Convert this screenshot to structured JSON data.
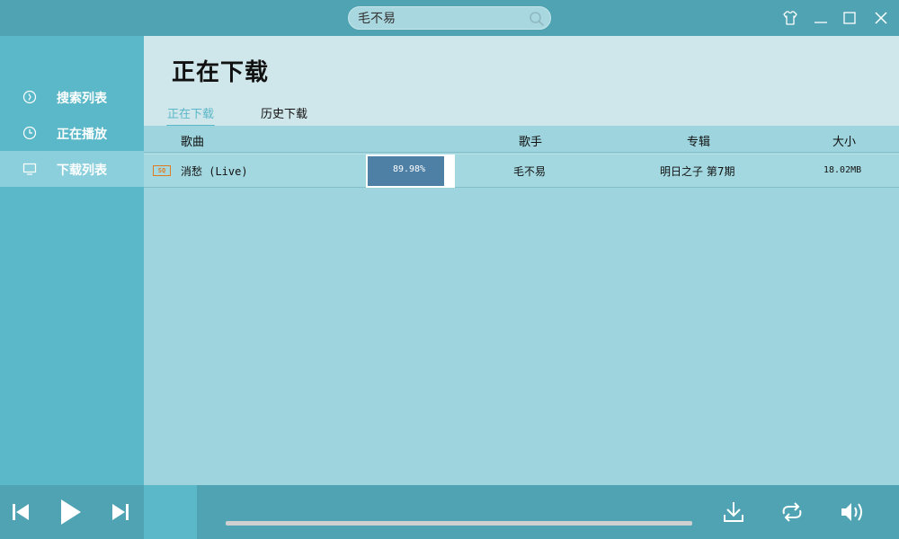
{
  "search": {
    "value": "毛不易"
  },
  "window_controls": [
    "skin-icon",
    "minimize-icon",
    "maximize-icon",
    "close-icon"
  ],
  "sidebar": {
    "items": [
      {
        "label": "搜索列表",
        "icon": "search-list-icon"
      },
      {
        "label": "正在播放",
        "icon": "clock-icon"
      },
      {
        "label": "下载列表",
        "icon": "monitor-icon",
        "active": true
      }
    ]
  },
  "main": {
    "title": "正在下载",
    "tabs": [
      {
        "label": "正在下载",
        "active": true
      },
      {
        "label": "历史下载",
        "active": false
      }
    ],
    "columns": {
      "song": "歌曲",
      "artist": "歌手",
      "album": "专辑",
      "size": "大小"
    },
    "rows": [
      {
        "badge": "SQ",
        "song": "消愁 (Live)",
        "progress_text": "89.98%",
        "progress": 0.8998,
        "artist": "毛不易",
        "album": "明日之子 第7期",
        "size": "18.02MB"
      }
    ]
  },
  "player": {
    "controls": [
      "previous-icon",
      "play-icon",
      "next-icon",
      "download-icon",
      "repeat-icon",
      "volume-icon"
    ]
  },
  "colors": {
    "titlebar": "#4fa3b2",
    "sidebar": "#5bb8c8",
    "accent": "#5bb8c8",
    "progress": "#4e7fa5",
    "badge": "#e07a1f"
  }
}
